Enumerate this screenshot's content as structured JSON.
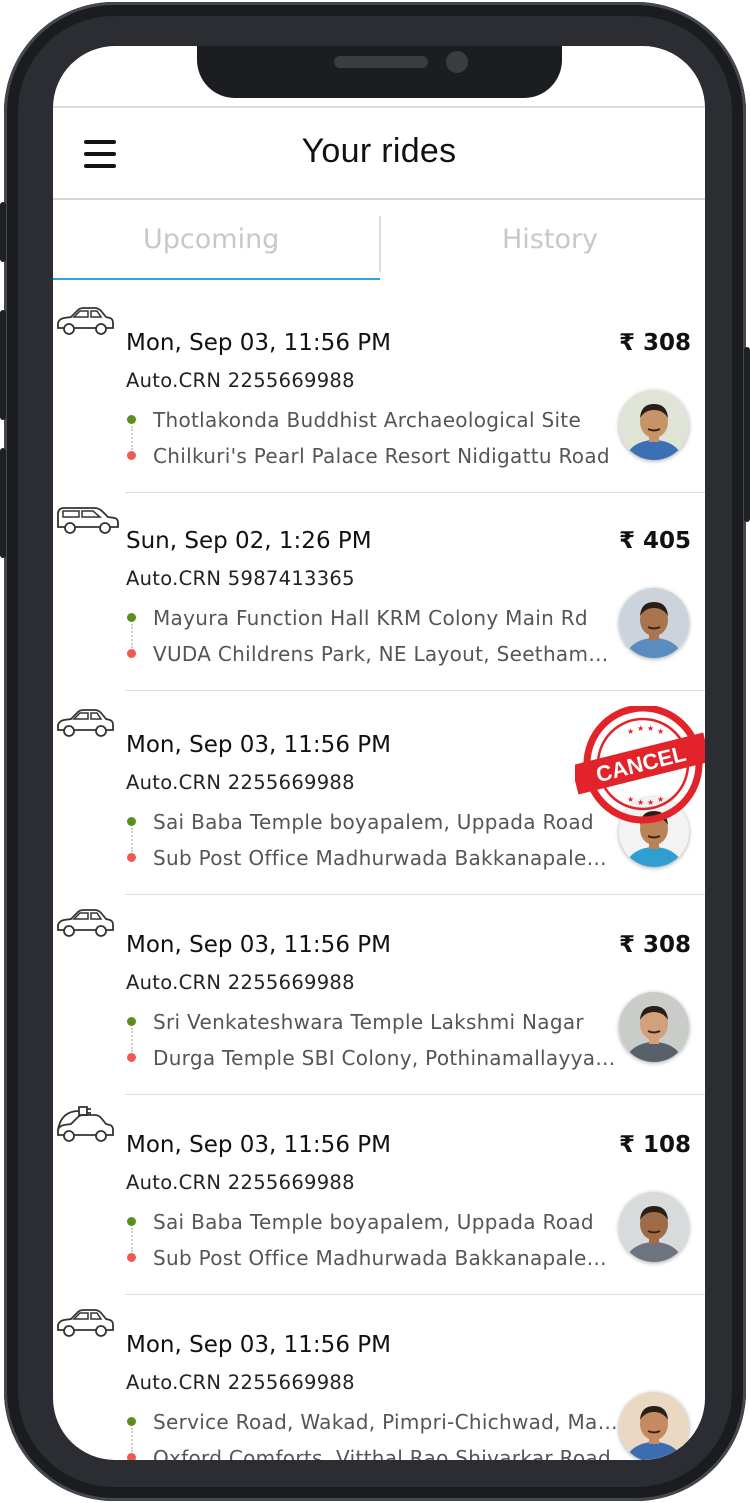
{
  "header": {
    "title": "Your rides",
    "menu_icon": "hamburger-menu-icon"
  },
  "tabs": [
    {
      "label": "Upcoming",
      "active": true
    },
    {
      "label": "History",
      "active": false
    }
  ],
  "colors": {
    "accent": "#2aa6dc",
    "pickup_dot": "#5b8f1a",
    "drop_dot": "#ef5b53"
  },
  "rides": [
    {
      "vehicle": "sedan-car-icon",
      "date": "Mon, Sep 03, 11:56 PM",
      "crn": "Auto.CRN 2255669988",
      "price": "₹ 308",
      "pickup": "Thotlakonda Buddhist Archaeological Site",
      "drop": "Chilkuri's Pearl Palace Resort Nidigattu Road",
      "cancelled": false
    },
    {
      "vehicle": "suv-car-icon",
      "date": "Sun, Sep 02, 1:26 PM",
      "crn": "Auto.CRN 5987413365",
      "price": "₹ 405",
      "pickup": "Mayura Function Hall  KRM Colony Main Rd",
      "drop": "VUDA Childrens Park, NE Layout, Seethammadhara",
      "cancelled": false
    },
    {
      "vehicle": "sedan-car-icon",
      "date": "Mon, Sep 03, 11:56 PM",
      "crn": "Auto.CRN 2255669988",
      "price": "",
      "pickup": "Sai Baba Temple boyapalem, Uppada Road",
      "drop": "Sub Post Office Madhurwada Bakkanapalem Road",
      "cancelled": true,
      "stamp_text": "CANCEL"
    },
    {
      "vehicle": "sedan-car-icon",
      "date": "Mon, Sep 03, 11:56 PM",
      "crn": "Auto.CRN 2255669988",
      "price": "₹ 308",
      "pickup": "Sri Venkateshwara Temple Lakshmi Nagar",
      "drop": "Durga Temple SBI Colony, Pothinamallayya Palem",
      "cancelled": false
    },
    {
      "vehicle": "electric-car-icon",
      "date": "Mon, Sep 03, 11:56 PM",
      "crn": "Auto.CRN 2255669988",
      "price": "₹ 108",
      "pickup": "Sai Baba Temple boyapalem, Uppada Road",
      "drop": "Sub Post Office Madhurwada Bakkanapalem Road",
      "cancelled": false
    },
    {
      "vehicle": "sedan-car-icon",
      "date": "Mon, Sep 03, 11:56 PM",
      "crn": "Auto.CRN 2255669988",
      "price": "",
      "pickup": "Service Road, Wakad, Pimpri-Chichwad, Maharashtra",
      "drop": "Oxford Comforts, Vitthal Rao Shivarkar Road",
      "cancelled": false
    }
  ]
}
